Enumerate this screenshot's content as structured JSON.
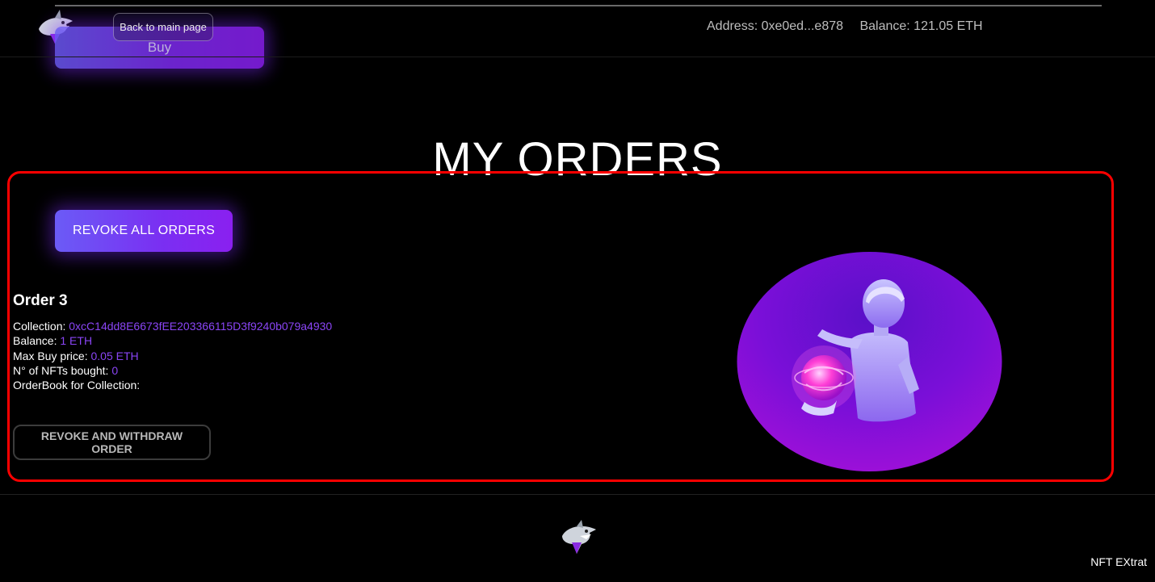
{
  "header": {
    "buy_label": "Buy",
    "back_label": "Back to main page",
    "address": "Address: 0xe0ed...e878",
    "balance": "Balance: 121.05 ETH"
  },
  "main": {
    "title": "MY ORDERS",
    "revoke_all_label": "REVOKE ALL ORDERS",
    "order": {
      "title": "Order 3",
      "collection_label": "Collection:",
      "collection_value": "0xcC14dd8E6673fEE203366115D3f9240b079a4930",
      "balance_label": "Balance:",
      "balance_value": "1 ETH",
      "max_buy_label": "Max Buy price:",
      "max_buy_value": "0.05 ETH",
      "nfts_bought_label": "N° of NFTs bought:",
      "nfts_bought_value": "0",
      "orderbook_label": "OrderBook for Collection:"
    },
    "revoke_withdraw_label": "REVOKE AND WITHDRAW ORDER"
  },
  "footer": {
    "brand": "NFT EXtrat"
  },
  "colors": {
    "accent": "#8a45f5",
    "highlight": "#ff0000",
    "button_gradient_start": "#6b5bf6",
    "button_gradient_end": "#8a20f0"
  },
  "icons": {
    "logo": "shark-logo-icon",
    "nft": "robot-holding-globe-image"
  }
}
